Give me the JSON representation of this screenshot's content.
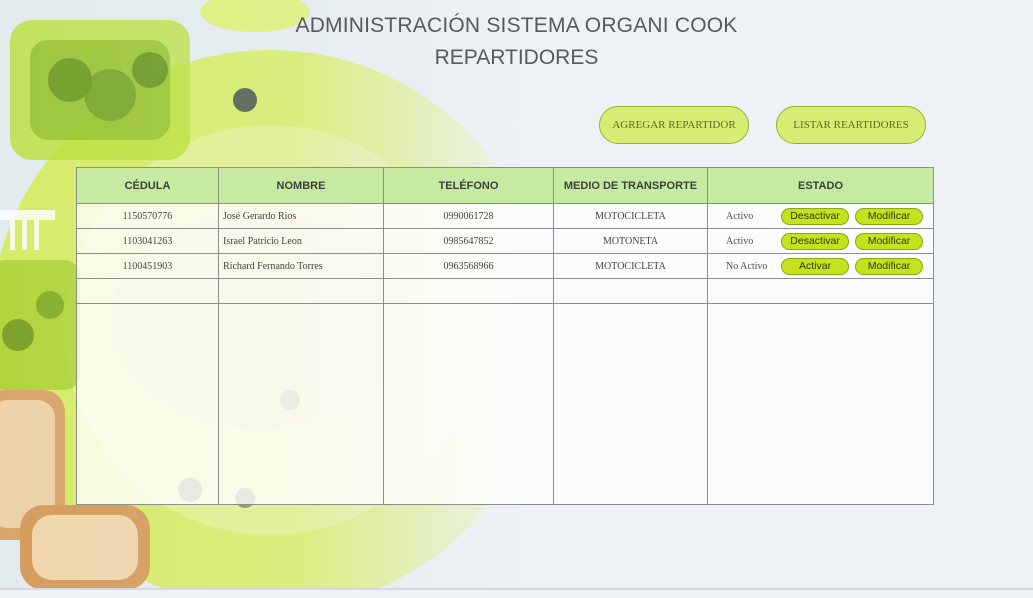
{
  "page": {
    "title": "ADMINISTRACIÓN SISTEMA ORGANI COOK",
    "subtitle": "REPARTIDORES"
  },
  "actions": {
    "add_label": "AGREGAR REPARTIDOR",
    "list_label": "LISTAR REARTIDORES"
  },
  "table": {
    "headers": {
      "cedula": "CÉDULA",
      "nombre": "NOMBRE",
      "telefono": "TELÉFONO",
      "transporte": "MEDIO DE TRANSPORTE",
      "estado": "ESTADO"
    },
    "rows": [
      {
        "cedula": "1150570776",
        "nombre": "José Gerardo Rios",
        "telefono": "0990061728",
        "transporte": "MOTOCICLETA",
        "estado": "Activo",
        "toggle": "Desactivar",
        "edit": "Modificar"
      },
      {
        "cedula": "1103041263",
        "nombre": "Israel Patricio Leon",
        "telefono": "0985647852",
        "transporte": "MOTONETA",
        "estado": "Activo",
        "toggle": "Desactivar",
        "edit": "Modificar"
      },
      {
        "cedula": "1100451903",
        "nombre": "Richard Fernando Torres",
        "telefono": "0963568966",
        "transporte": "MOTOCICLETA",
        "estado": "No Activo",
        "toggle": "Activar",
        "edit": "Modificar"
      }
    ]
  },
  "colors": {
    "accent": "#c4e21d",
    "header_bg": "#c7eaa3",
    "pill_bg": "#d7ec72"
  }
}
